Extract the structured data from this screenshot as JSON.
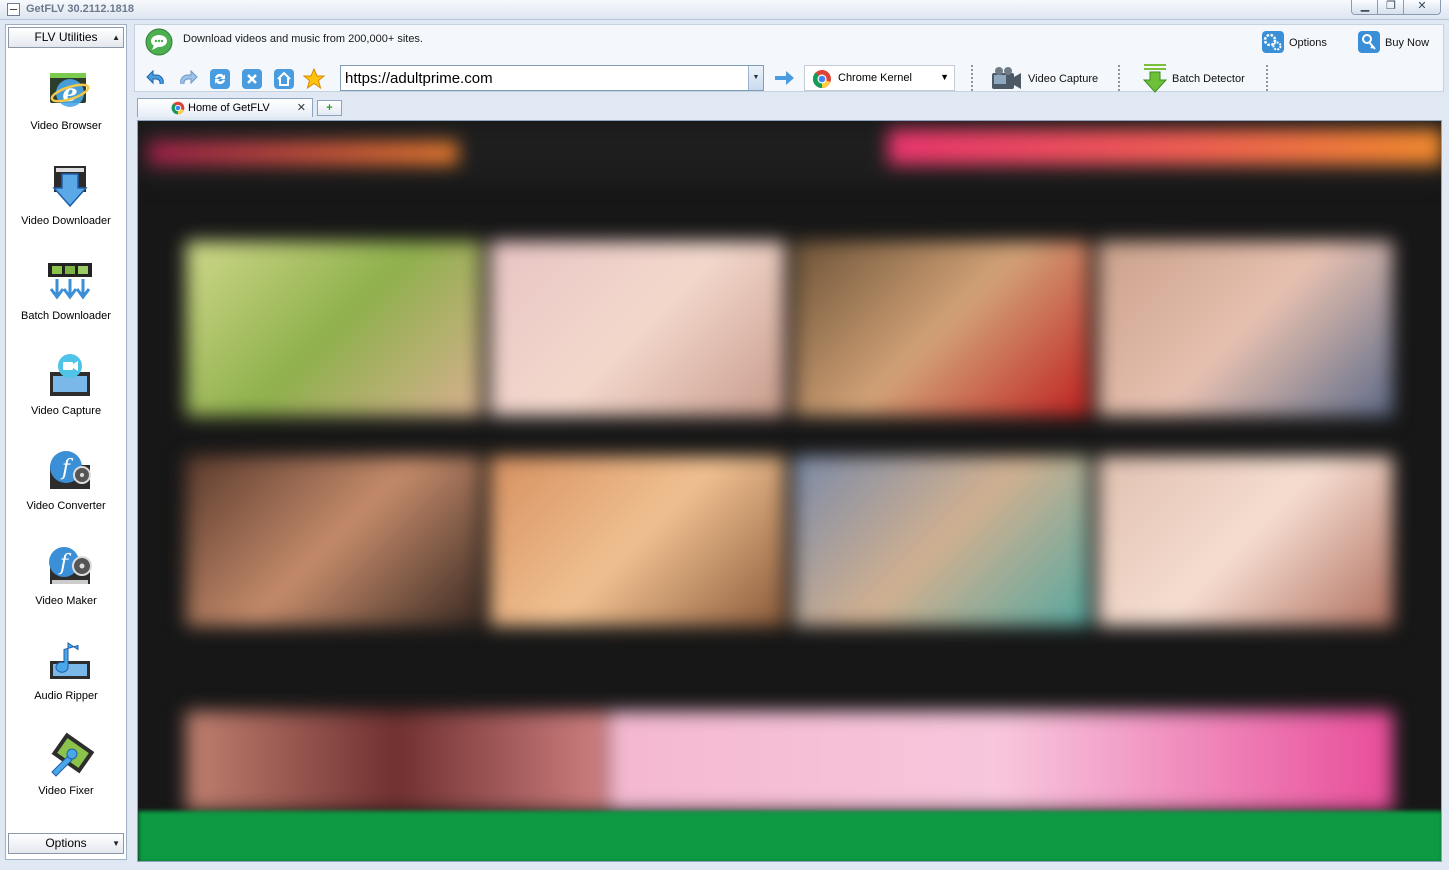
{
  "window": {
    "title": "GetFLV 30.2112.1818"
  },
  "left_panel": {
    "utilities_label": "FLV Utilities",
    "tools": [
      {
        "label": "Video Browser",
        "icon": "video-browser-icon"
      },
      {
        "label": "Video Downloader",
        "icon": "download-arrow-icon"
      },
      {
        "label": "Batch Downloader",
        "icon": "batch-download-icon"
      },
      {
        "label": "Video Capture",
        "icon": "video-camera-icon"
      },
      {
        "label": "Video Converter",
        "icon": "film-converter-icon"
      },
      {
        "label": "Video Maker",
        "icon": "film-maker-icon"
      },
      {
        "label": "Audio Ripper",
        "icon": "music-note-icon"
      },
      {
        "label": "Video Fixer",
        "icon": "wrench-film-icon"
      }
    ],
    "options_label": "Options"
  },
  "header": {
    "tagline": "Download videos and music from 200,000+ sites.",
    "options_label": "Options",
    "buy_now_label": "Buy Now"
  },
  "navbar": {
    "url": "https://adultprime.com",
    "kernel": "Chrome Kernel",
    "video_capture_label": "Video Capture",
    "batch_detector_label": "Batch Detector"
  },
  "tabs": [
    {
      "label": "Home of GetFLV",
      "active": true
    }
  ],
  "colors": {
    "accent": "#3b8fd6",
    "panel_bg": "#dfe8f3",
    "page_bg": "#171717",
    "banner_pink": "#e8356d",
    "status_green": "#0d9a43"
  }
}
